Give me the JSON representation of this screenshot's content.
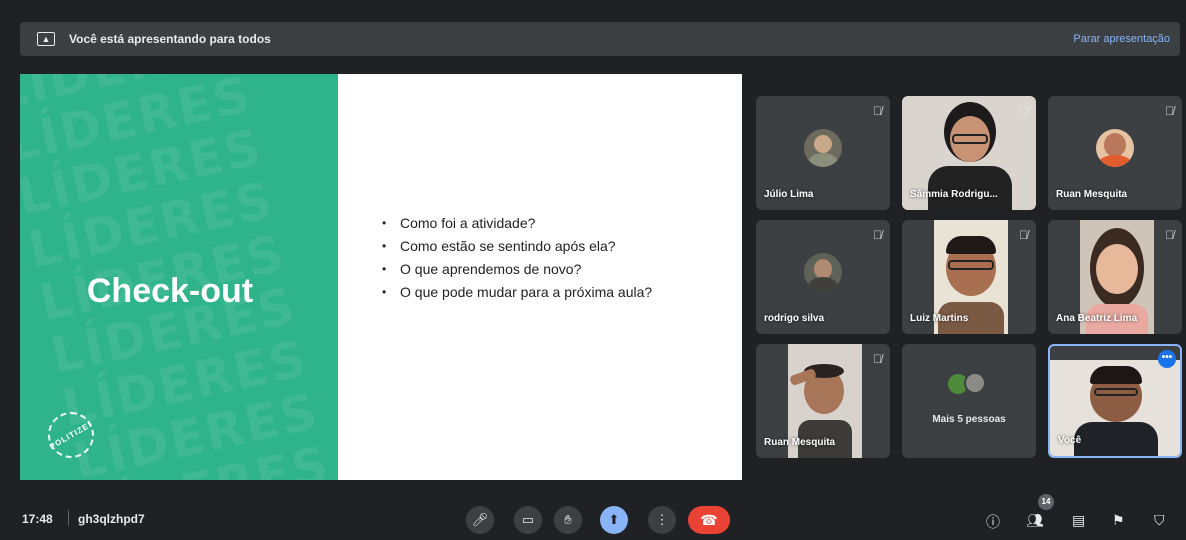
{
  "banner": {
    "text": "Você está apresentando para todos",
    "stop_label": "Parar apresentação",
    "icon": "present-screen-icon"
  },
  "slide": {
    "title": "Check-out",
    "pattern_word": "LÍDERES",
    "badge_text": "POLITIZE!",
    "bullets": [
      "Como foi a atividade?",
      "Como estão se sentindo após ela?",
      "O que aprendemos de novo?",
      "O que pode mudar para a próxima aula?"
    ],
    "accent_color": "#2eb488"
  },
  "participants": [
    {
      "name": "Júlio Lima",
      "muted": true
    },
    {
      "name": "Sâmmia Rodrigu...",
      "muted": true
    },
    {
      "name": "Ruan Mesquita",
      "muted": true
    },
    {
      "name": "rodrigo silva",
      "muted": true
    },
    {
      "name": "Luiz Martins",
      "muted": true
    },
    {
      "name": "Ana Beatriz Lima",
      "muted": true
    },
    {
      "name": "Ruan Mesquita",
      "muted": true
    },
    {
      "name": "Mais 5 pessoas",
      "muted": false
    },
    {
      "name": "Você",
      "muted": false
    }
  ],
  "bottom_bar": {
    "time": "17:48",
    "meeting_code": "gh3qlzhpd7",
    "people_count": "14",
    "controls": [
      "mic-icon",
      "camera-icon",
      "raise-hand-icon",
      "present-icon",
      "more-options-icon",
      "end-call-icon"
    ],
    "side_icons": [
      "info-icon",
      "people-icon",
      "chat-icon",
      "activities-icon",
      "host-controls-icon"
    ]
  },
  "colors": {
    "background": "#202124",
    "tile": "#3c4043",
    "accent_blue": "#8ab4f8",
    "end_call": "#ea4335"
  }
}
